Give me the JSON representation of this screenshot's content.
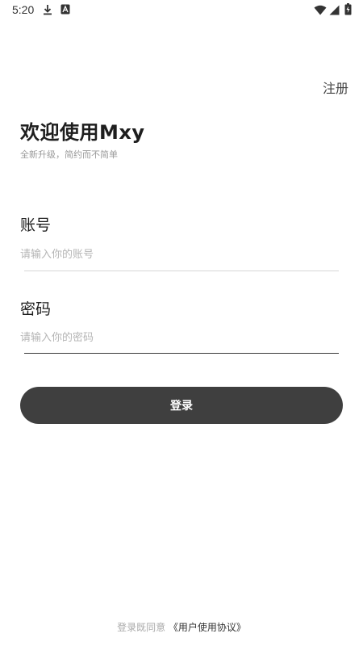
{
  "status_bar": {
    "time": "5:20",
    "icons": [
      "download-icon",
      "app-notification-icon",
      "wifi-icon",
      "signal-icon",
      "battery-icon"
    ]
  },
  "header": {
    "register_label": "注册"
  },
  "welcome": {
    "title": "欢迎使用Mxy",
    "subtitle": "全新升级，简约而不简单"
  },
  "form": {
    "account_label": "账号",
    "account_placeholder": "请输入你的账号",
    "account_value": "",
    "password_label": "密码",
    "password_placeholder": "请输入你的密码",
    "password_value": ""
  },
  "login_button_label": "登录",
  "agreement": {
    "prefix": "登录既同意",
    "link": "《用户使用协议》"
  },
  "colors": {
    "button_bg": "#3f3f3f",
    "button_text": "#ffffff",
    "placeholder": "#b5b5b5",
    "subtitle": "#9a9a9a"
  }
}
